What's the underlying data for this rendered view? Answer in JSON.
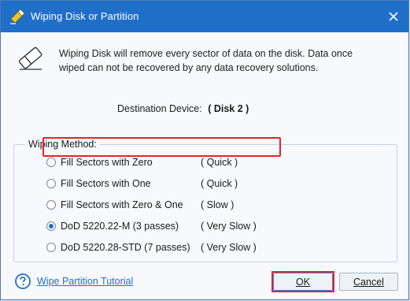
{
  "titlebar": {
    "icon": "wipe-disk-app-icon",
    "title": "Wiping Disk or Partition",
    "close_icon": "close-icon"
  },
  "message": {
    "icon": "eraser-icon",
    "line1": "Wiping Disk will remove every sector of data on the disk. Data once",
    "line2": "wiped can not be recovered by any data recovery solutions."
  },
  "destination": {
    "label": "Destination Device:",
    "value": "( Disk 2 )"
  },
  "wiping_method": {
    "legend": "Wiping Method:",
    "options": [
      {
        "label": "Fill Sectors with Zero",
        "speed": "( Quick )",
        "checked": false
      },
      {
        "label": "Fill Sectors with One",
        "speed": "( Quick )",
        "checked": false
      },
      {
        "label": "Fill Sectors with Zero & One",
        "speed": "( Slow )",
        "checked": false
      },
      {
        "label": "DoD 5220.22-M (3 passes)",
        "speed": "( Very Slow )",
        "checked": true
      },
      {
        "label": "DoD 5220.28-STD (7 passes)",
        "speed": "( Very Slow )",
        "checked": false
      }
    ],
    "highlight_color": "#e8222b"
  },
  "footer": {
    "help_icon": "help-icon",
    "tutorial_link": "Wipe Partition Tutorial",
    "ok_label": "OK",
    "cancel_label": "Cancel"
  },
  "colors": {
    "titlebar": "#1f6fc9",
    "accent": "#1f6fc9",
    "highlight": "#e8222b"
  }
}
